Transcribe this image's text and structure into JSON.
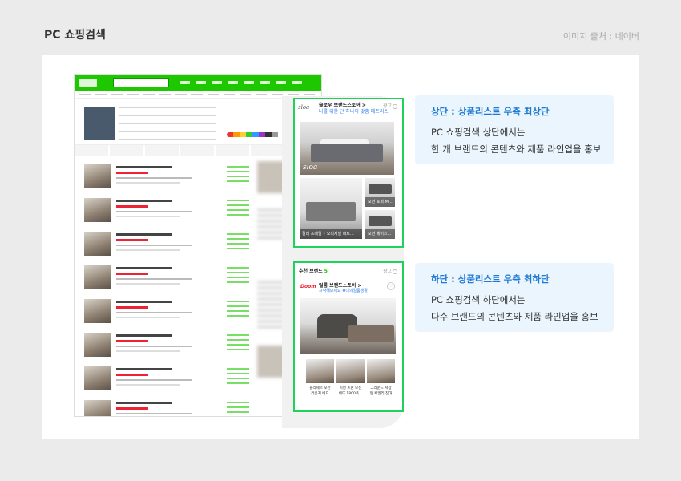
{
  "header": {
    "title": "PC 쇼핑검색",
    "source": "이미지 출처 : 네이버"
  },
  "top_card": {
    "brand_logo": "sloa",
    "brand_name": "슬로우 브랜드스토어 >",
    "brand_sub": "나를 위한 단 하나의 맞춤 매트리스",
    "ad_label": "광고",
    "hero_logo": "sloa",
    "caption_left": "컬리 프레임 • 오리지널 매트...",
    "caption_right_1": "모션 토퍼 M...",
    "caption_right_2": "모션 베이스..."
  },
  "bottom_card": {
    "heading": "추천 브랜드",
    "count": "5",
    "ad_label": "광고",
    "brand_logo": "Doom",
    "brand_name": "일룸 브랜드스토어 >",
    "brand_sub": "시작해보세요 #나의일룸생활",
    "products": [
      "플라세르 모션\n라운지 베드",
      "이엔 트윈 모션\n베드 1800폭...",
      "그라운드 저상\n형 패밀리 침대"
    ]
  },
  "info_top": {
    "heading": "상단 : 상품리스트 우측 최상단",
    "line1": "PC 쇼핑검색 상단에서는",
    "line2": "한 개 브랜드의 콘텐츠와 제품 라인업을 홍보"
  },
  "info_bottom": {
    "heading": "하단 : 상품리스트 우측 최하단",
    "line1": "PC 쇼핑검색 하단에서는",
    "line2": "다수 브랜드의 콘텐츠와 제품 라인업을 홍보"
  },
  "colors": {
    "accent_green": "#1fd35a",
    "naver_green": "#1ec800",
    "heading_blue": "#1f7ad6",
    "info_bg": "#eaf5fd"
  }
}
